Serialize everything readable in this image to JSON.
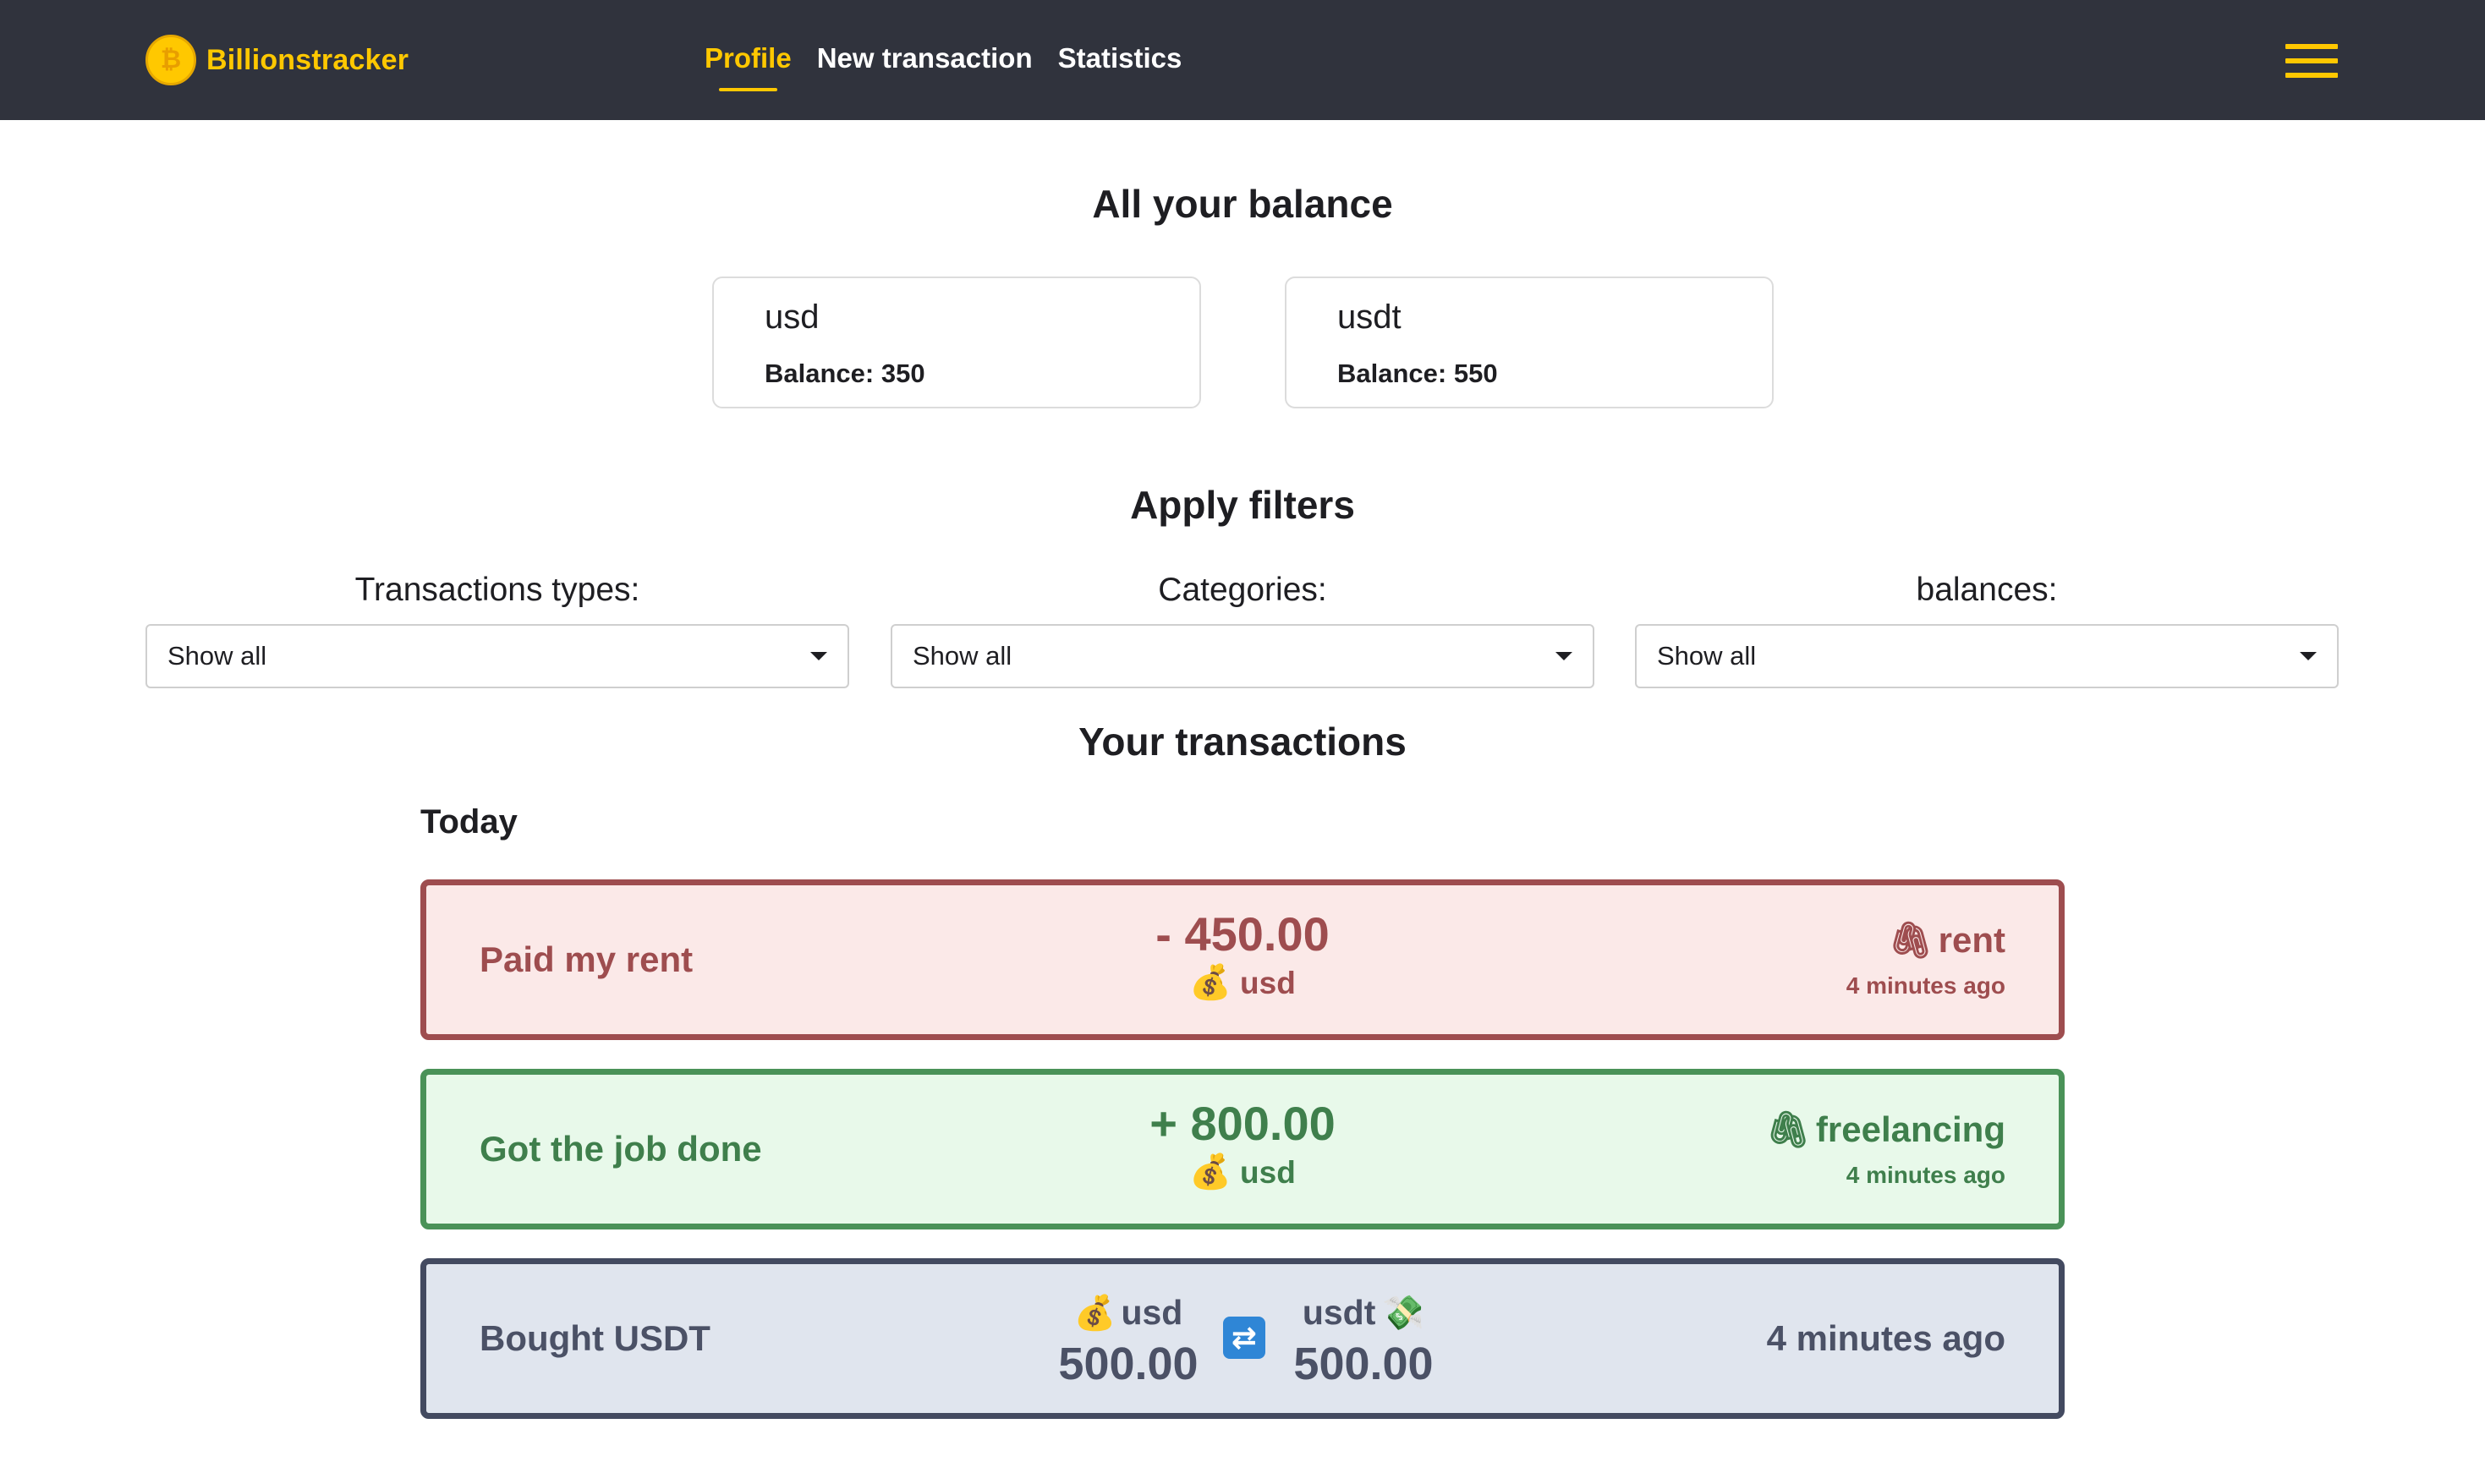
{
  "navbar": {
    "brand": "Billionstracker",
    "brand_icon": "bitcoin-coin-icon",
    "links": [
      {
        "label": "Profile",
        "active": true
      },
      {
        "label": "New transaction",
        "active": false
      },
      {
        "label": "Statistics",
        "active": false
      }
    ],
    "menu_icon": "hamburger-menu-icon",
    "accent_color": "#ffc800",
    "background_color": "#30333d"
  },
  "balance_section": {
    "title": "All your balance",
    "cards": [
      {
        "currency": "usd",
        "balance_text": "Balance: 350"
      },
      {
        "currency": "usdt",
        "balance_text": "Balance: 550"
      }
    ]
  },
  "filters": {
    "title": "Apply filters",
    "items": [
      {
        "label": "Transactions types:",
        "value": "Show all"
      },
      {
        "label": "Categories:",
        "value": "Show all"
      },
      {
        "label": "balances:",
        "value": "Show all"
      }
    ]
  },
  "transactions": {
    "title": "Your transactions",
    "groups": [
      {
        "label": "Today",
        "items": [
          {
            "type": "expense",
            "title": "Paid my rent",
            "amount": "- 450.00",
            "currency": "usd",
            "currency_icon": "money-bag-icon",
            "category": "rent",
            "category_icon": "paperclip-icon",
            "time": "4 minutes ago",
            "color": "#9e4d4f"
          },
          {
            "type": "income",
            "title": "Got the job done",
            "amount": "+ 800.00",
            "currency": "usd",
            "currency_icon": "money-bag-icon",
            "category": "freelancing",
            "category_icon": "paperclip-icon",
            "time": "4 minutes ago",
            "color": "#4a9258"
          },
          {
            "type": "exchange",
            "title": "Bought USDT",
            "from_currency": "usd",
            "from_icon": "money-bag-icon",
            "from_amount": "500.00",
            "to_currency": "usdt",
            "to_icon": "flying-money-icon",
            "to_amount": "500.00",
            "exchange_icon": "repeat-arrows-icon",
            "time": "4 minutes ago",
            "color": "#434a60"
          }
        ]
      }
    ]
  }
}
